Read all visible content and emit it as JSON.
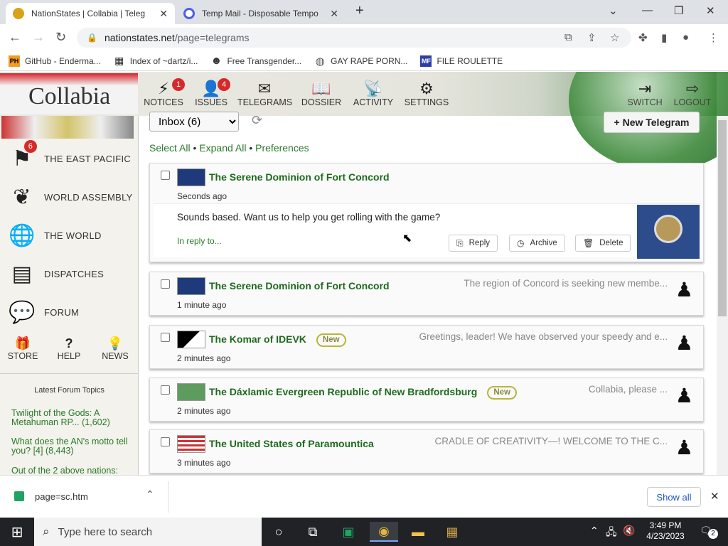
{
  "browser": {
    "tabs": [
      {
        "title": "NationStates | Collabia | Teleg",
        "favicon_color": "#d9a21b"
      },
      {
        "title": "Temp Mail - Disposable Tempo",
        "favicon_color": "#4a60e8"
      }
    ],
    "new_tab": "+",
    "url_host": "nationstates.net",
    "url_path": "/page=telegrams",
    "bookmarks": [
      {
        "label": "GitHub - Enderma...",
        "icon": "PH",
        "color": "#f59b1f"
      },
      {
        "label": "Index of ~dartz/i...",
        "icon": "▦",
        "color": "#222"
      },
      {
        "label": "Free Transgender...",
        "icon": "☻",
        "color": "#333"
      },
      {
        "label": "GAY RAPE PORN...",
        "icon": "◍",
        "color": "#555"
      },
      {
        "label": "FILE ROULETTE",
        "icon": "MF",
        "color": "#2d3ea8"
      }
    ]
  },
  "site": {
    "logo": "Collabia",
    "nav": [
      {
        "label": "NOTICES",
        "icon": "⚡",
        "badge": "1"
      },
      {
        "label": "ISSUES",
        "icon": "👤",
        "badge": "4"
      },
      {
        "label": "TELEGRAMS",
        "icon": "✉",
        "badge": ""
      },
      {
        "label": "DOSSIER",
        "icon": "📖",
        "badge": ""
      },
      {
        "label": "ACTIVITY",
        "icon": "📡",
        "badge": ""
      },
      {
        "label": "SETTINGS",
        "icon": "⚙",
        "badge": ""
      }
    ],
    "nav_right": [
      {
        "label": "SWITCH",
        "icon": "⇥"
      },
      {
        "label": "LOGOUT",
        "icon": "⇨"
      }
    ],
    "left_menu": [
      {
        "label": "THE EAST PACIFIC",
        "icon": "⚑",
        "badge": "6"
      },
      {
        "label": "WORLD ASSEMBLY",
        "icon": "❦",
        "badge": ""
      },
      {
        "label": "THE WORLD",
        "icon": "🌐",
        "badge": ""
      },
      {
        "label": "DISPATCHES",
        "icon": "▤",
        "badge": ""
      },
      {
        "label": "FORUM",
        "icon": "💬",
        "badge": ""
      }
    ],
    "small_menu": [
      {
        "label": "STORE",
        "icon": "🎁"
      },
      {
        "label": "HELP",
        "icon": "?"
      },
      {
        "label": "NEWS",
        "icon": "💡"
      }
    ],
    "forum_heading": "Latest Forum Topics",
    "forum_topics": [
      "Twilight of the Gods: A Metahuman RP... (1,602)",
      "What does the AN's motto tell you? [4] (8,443)",
      "Out of the 2 above nations:"
    ]
  },
  "telegrams": {
    "folder": "Inbox (6)",
    "new_button": "+ New Telegram",
    "links": [
      "Select All",
      "Expand All",
      "Preferences"
    ],
    "expanded": {
      "sender": "The Serene Dominion of Fort Concord",
      "time": "Seconds ago",
      "message": "Sounds based. Want us to help you get rolling with the game?",
      "in_reply": "In reply to...",
      "reply": "Reply",
      "archive": "Archive",
      "delete": "Delete"
    },
    "items": [
      {
        "sender": "The Serene Dominion of Fort Concord",
        "time": "1 minute ago",
        "preview": "The region of Concord is seeking new membe...",
        "new": ""
      },
      {
        "sender": "The Komar of IDEVK",
        "time": "2 minutes ago",
        "preview": "Greetings, leader! We have observed your speedy and e...",
        "new": "New"
      },
      {
        "sender": "The Dáxlamic Evergreen Republic of New Bradfordsburg",
        "time": "2 minutes ago",
        "preview": "Collabia, please ...",
        "new": "New"
      },
      {
        "sender": "The United States of Paramountica",
        "time": "3 minutes ago",
        "preview": "CRADLE OF CREATIVITY—! WELCOME TO THE C...",
        "new": ""
      }
    ]
  },
  "download": {
    "file": "page=sc.htm",
    "show_all": "Show all"
  },
  "taskbar": {
    "search": "Type here to search",
    "time": "3:49 PM",
    "date": "4/23/2023",
    "notif": "2"
  }
}
